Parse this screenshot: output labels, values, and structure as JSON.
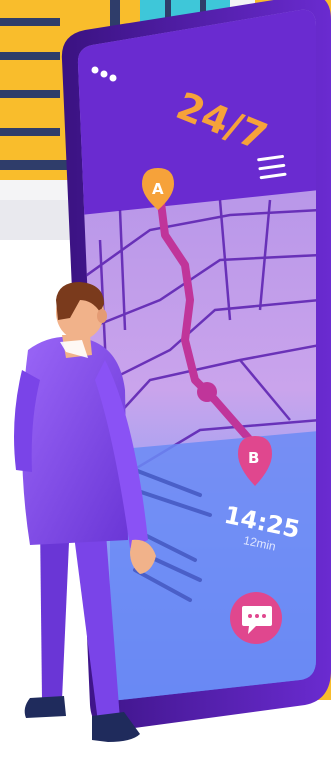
{
  "app": {
    "title": "24/7",
    "menu_icon": "hamburger-icon",
    "more_icon": "ellipsis-icon"
  },
  "map": {
    "start_marker": "A",
    "end_marker": "B",
    "route_color": "#c0359a"
  },
  "eta": {
    "time": "14:25",
    "duration": "12min"
  },
  "actions": {
    "chat_icon": "chat-icon"
  },
  "colors": {
    "phone_purple": "#5a1fb0",
    "screen_lilac": "#b89ae8",
    "accent_orange": "#f6a23a",
    "accent_pink": "#e0478e",
    "suit_purple": "#8a4ff0"
  }
}
